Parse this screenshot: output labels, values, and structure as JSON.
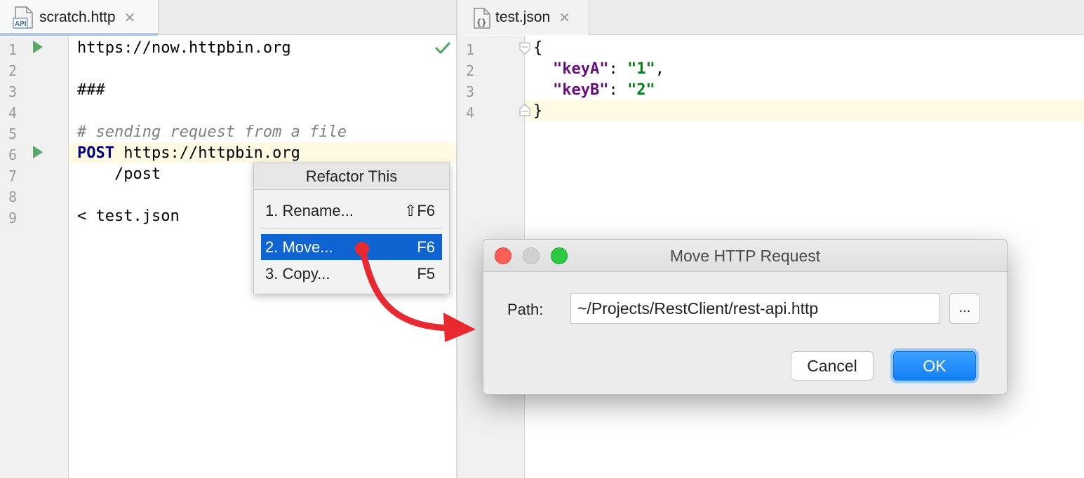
{
  "left_editor": {
    "tab_label": "scratch.http",
    "lines": [
      {
        "no": "1",
        "text": "https://now.httpbin.org"
      },
      {
        "no": "2",
        "text": ""
      },
      {
        "no": "3",
        "text": "###"
      },
      {
        "no": "4",
        "text": ""
      },
      {
        "no": "5",
        "text": "# sending request from a file"
      },
      {
        "no": "6",
        "method": "POST",
        "text": " https://httpbin.org"
      },
      {
        "no": "7",
        "text": "    /post"
      },
      {
        "no": "8",
        "text": ""
      },
      {
        "no": "9",
        "text": "< test.json"
      }
    ]
  },
  "right_editor": {
    "tab_label": "test.json",
    "line_numbers": [
      "1",
      "2",
      "3",
      "4"
    ],
    "lines": [
      {
        "open": "{"
      },
      {
        "key": "\"keyA\"",
        "sep": ": ",
        "value": "\"1\"",
        "trail": ","
      },
      {
        "key": "\"keyB\"",
        "sep": ": ",
        "value": "\"2\"",
        "trail": ""
      },
      {
        "close": "}"
      }
    ]
  },
  "refactor_popup": {
    "title": "Refactor This",
    "items": [
      {
        "label": "1. Rename...",
        "shortcut": "⇧F6"
      },
      {
        "label": "2. Move...",
        "shortcut": "F6",
        "selected": true
      },
      {
        "label": "3. Copy...",
        "shortcut": "F5"
      }
    ]
  },
  "move_dialog": {
    "title": "Move HTTP Request",
    "path_label": "Path:",
    "path_value": "~/Projects/RestClient/rest-api.http",
    "browse_label": "...",
    "cancel_label": "Cancel",
    "ok_label": "OK"
  },
  "icons": {
    "run": "run-gutter-icon",
    "check": "checkmark-icon",
    "http_file": "http-file-icon",
    "json_file": "json-file-icon",
    "close": "close-tab-icon",
    "arrow": "red-curved-arrow"
  },
  "colors": {
    "selection": "#0f64d2",
    "ok_button": "#137ff7",
    "arrow": "#e8292f",
    "run": "#59a869"
  }
}
